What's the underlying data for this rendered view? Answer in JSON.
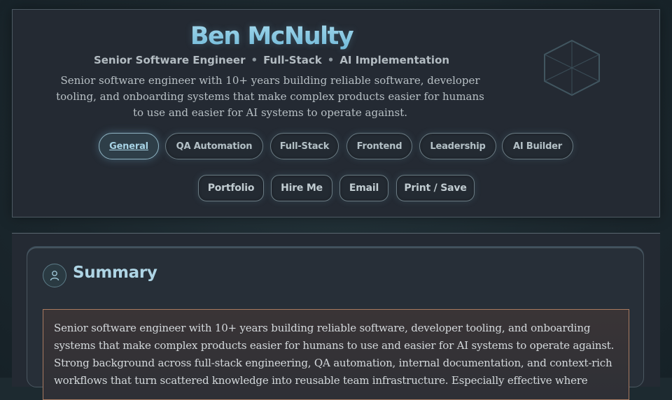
{
  "header": {
    "name": "Ben McNulty",
    "roles": [
      "Senior Software Engineer",
      "Full-Stack",
      "AI Implementation"
    ],
    "separator": "•",
    "intro": "Senior software engineer with 10+ years building reliable software, developer tooling, and onboarding systems that make complex products easier for humans to use and easier for AI systems to operate against."
  },
  "tabs": [
    {
      "label": "General",
      "active": true
    },
    {
      "label": "QA Automation",
      "active": false
    },
    {
      "label": "Full-Stack",
      "active": false
    },
    {
      "label": "Frontend",
      "active": false
    },
    {
      "label": "Leadership",
      "active": false
    },
    {
      "label": "AI Builder",
      "active": false
    }
  ],
  "actions": [
    {
      "label": "Portfolio"
    },
    {
      "label": "Hire Me"
    },
    {
      "label": "Email"
    },
    {
      "label": "Print / Save"
    }
  ],
  "summary": {
    "title": "Summary",
    "icon": "user-icon",
    "text": "Senior software engineer with 10+ years building reliable software, developer tooling, and onboarding systems that make complex products easier for humans to use and easier for AI systems to operate against. Strong background across full-stack engineering, QA automation, internal documentation, and context-rich workflows that turn scattered knowledge into reusable team infrastructure. Especially effective where"
  },
  "colors": {
    "accent": "#8ecbe4",
    "card_bg": "#242a33",
    "highlight_border": "#a87a60"
  }
}
